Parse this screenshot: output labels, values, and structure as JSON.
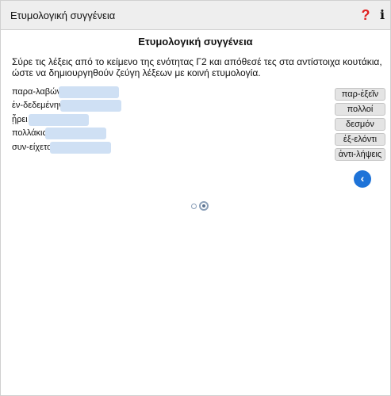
{
  "window": {
    "title": "Ετυμολογική συγγένεια"
  },
  "header": {
    "help_symbol": "?",
    "info_symbol": "i"
  },
  "exercise": {
    "heading": "Ετυμολογική συγγένεια",
    "instructions": "Σύρε τις λέξεις από το κείμενο της ενότητας Γ2 και απόθεσέ τες στα αντίστοιχα κουτάκια, ώστε να δημιουργηθούν ζεύγη λέξεων με κοινή ετυμολογία.",
    "pairs": [
      {
        "label": "παρα-λαβών",
        "answer": ""
      },
      {
        "label": "ἐν-δεδεμένην",
        "answer": ""
      },
      {
        "label": "ᾖρει",
        "answer": ""
      },
      {
        "label": "πολλάκις",
        "answer": ""
      },
      {
        "label": "συν-είχετο",
        "answer": ""
      }
    ],
    "choices": [
      "παρ-ἐξεῖν",
      "πολλοί",
      "δεσμόν",
      "ἐξ-ελόντι",
      "ἀντι-λήψεις"
    ]
  },
  "navigation": {
    "back_symbol": "‹",
    "pages": 2,
    "current_page": 2
  },
  "colors": {
    "accent": "#1e73d8",
    "drop_box": "#cfe0f4",
    "help": "#e02020"
  }
}
